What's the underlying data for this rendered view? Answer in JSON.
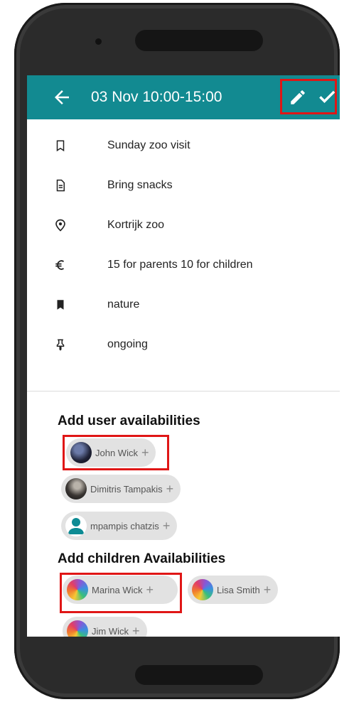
{
  "appbar": {
    "title": "03 Nov 10:00-15:00",
    "back_icon": "arrow-left-icon",
    "edit_icon": "pencil-icon",
    "confirm_icon": "check-icon",
    "color": "#128a91"
  },
  "details": [
    {
      "icon": "bookmark-outline-icon",
      "text": "Sunday zoo visit"
    },
    {
      "icon": "document-icon",
      "text": "Bring snacks"
    },
    {
      "icon": "location-pin-icon",
      "text": "Kortrijk zoo"
    },
    {
      "icon": "euro-icon",
      "text": "15 for parents 10 for children"
    },
    {
      "icon": "bookmark-filled-icon",
      "text": "nature"
    },
    {
      "icon": "pin-icon",
      "text": "ongoing"
    }
  ],
  "users_section": {
    "title": "Add user availabilities",
    "users": [
      {
        "name": "John Wick",
        "avatar": "photo-avatar",
        "highlighted": true
      },
      {
        "name": "Dimitris Tampakis",
        "avatar": "photo-avatar",
        "highlighted": false
      },
      {
        "name": "mpampis chatzis",
        "avatar": "person-icon",
        "highlighted": false
      }
    ]
  },
  "children_section": {
    "title": "Add children Availabilities",
    "children": [
      {
        "name": "Marina Wick",
        "avatar": "rainbow-avatar",
        "highlighted": true
      },
      {
        "name": "Lisa Smith",
        "avatar": "rainbow-avatar",
        "highlighted": false
      },
      {
        "name": "Jim Wick",
        "avatar": "rainbow-avatar",
        "highlighted": false
      }
    ]
  },
  "chip_add_symbol": "+",
  "highlight_color": "#e01616"
}
